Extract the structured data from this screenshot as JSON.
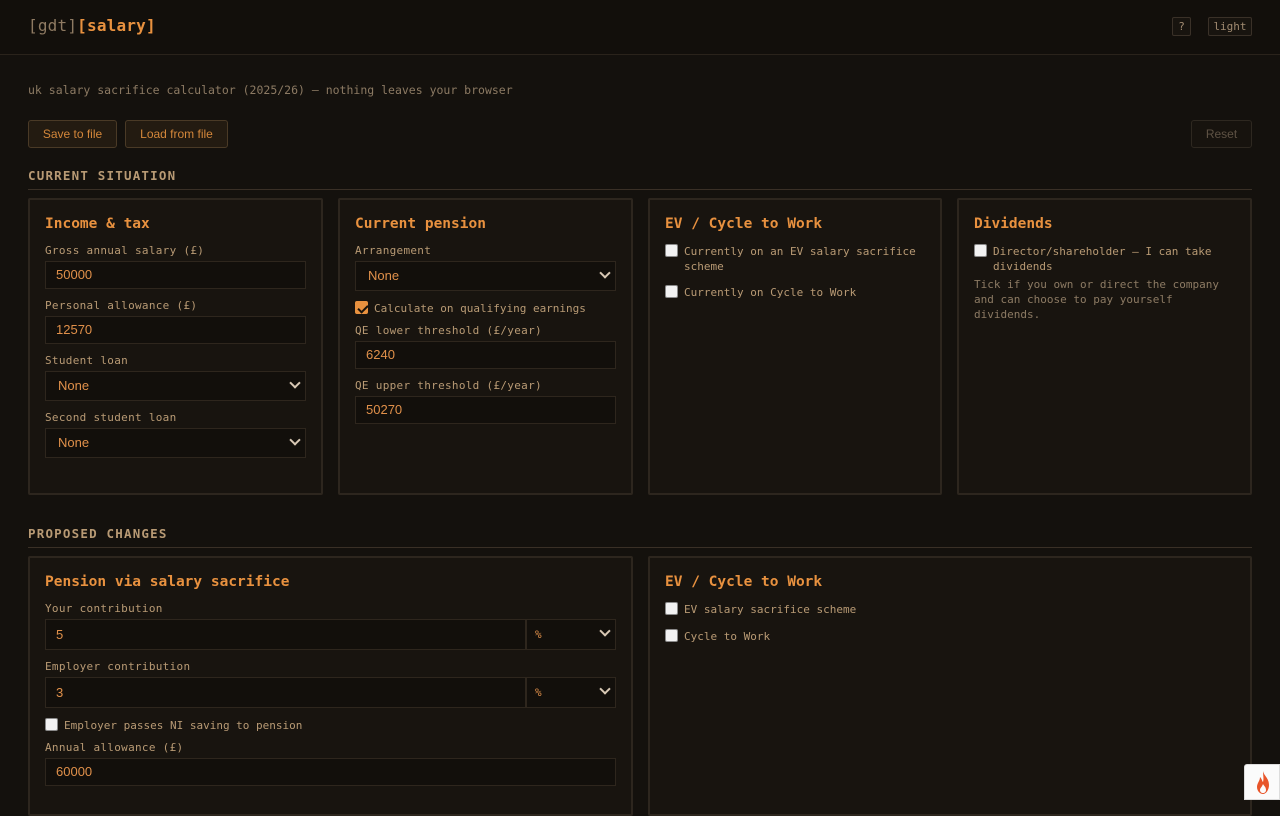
{
  "header": {
    "brand_prefix": "[gdt]",
    "brand_name": "[salary]",
    "help_label": "?",
    "theme_label": "light"
  },
  "tagline": "uk salary sacrifice calculator (2025/26) — nothing leaves your browser",
  "toolbar": {
    "save_label": "Save to file",
    "load_label": "Load from file",
    "reset_label": "Reset"
  },
  "current": {
    "section_title": "CURRENT SITUATION",
    "income": {
      "title": "Income & tax",
      "gross_label": "Gross annual salary (£)",
      "gross_value": "50000",
      "allowance_label": "Personal allowance (£)",
      "allowance_value": "12570",
      "student_loan_label": "Student loan",
      "student_loan_value": "None",
      "second_loan_label": "Second student loan",
      "second_loan_value": "None"
    },
    "pension": {
      "title": "Current pension",
      "arrangement_label": "Arrangement",
      "arrangement_value": "None",
      "qe_checkbox_label": "Calculate on qualifying earnings",
      "qe_lower_label": "QE lower threshold (£/year)",
      "qe_lower_value": "6240",
      "qe_upper_label": "QE upper threshold (£/year)",
      "qe_upper_value": "50270"
    },
    "ev": {
      "title": "EV / Cycle to Work",
      "ev_label": "Currently on an EV salary sacrifice scheme",
      "cycle_label": "Currently on Cycle to Work"
    },
    "dividends": {
      "title": "Dividends",
      "director_label": "Director/shareholder — I can take dividends",
      "hint": "Tick if you own or direct the company and can choose to pay yourself dividends."
    }
  },
  "proposed": {
    "section_title": "PROPOSED CHANGES",
    "pension": {
      "title": "Pension via salary sacrifice",
      "your_label": "Your contribution",
      "your_value": "5",
      "your_unit": "%",
      "employer_label": "Employer contribution",
      "employer_value": "3",
      "employer_unit": "%",
      "ni_label": "Employer passes NI saving to pension",
      "allowance_label": "Annual allowance (£)",
      "allowance_value": "60000"
    },
    "ev": {
      "title": "EV / Cycle to Work",
      "ev_label": "EV salary sacrifice scheme",
      "cycle_label": "Cycle to Work"
    }
  },
  "colors": {
    "accent": "#e8913f",
    "background": "#14110d",
    "text": "#b89a74"
  },
  "icons": {
    "corner_widget": "flame-icon"
  }
}
